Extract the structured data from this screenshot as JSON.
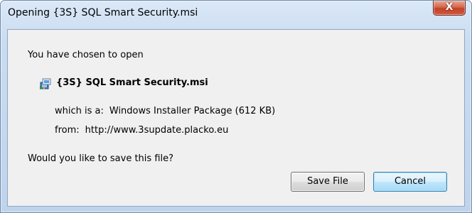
{
  "window": {
    "title": "Opening {3S} SQL Smart Security.msi",
    "close_glyph": "X"
  },
  "dialog": {
    "intro": "You have chosen to open",
    "file_name": "{3S} SQL Smart Security.msi",
    "file_icon": "msi-installer-icon",
    "which_label": "which is a:",
    "which_value": "Windows Installer Package (612  KB)",
    "from_label": "from:",
    "from_value": "http://www.3supdate.placko.eu",
    "question": "Would you like to save this file?"
  },
  "buttons": {
    "save_label": "Save File",
    "cancel_label": "Cancel"
  },
  "colors": {
    "close_button": "#c2412a",
    "frame": "#bfd4ec",
    "client": "#f0f0f0",
    "default_button_border": "#3c7fb1"
  }
}
